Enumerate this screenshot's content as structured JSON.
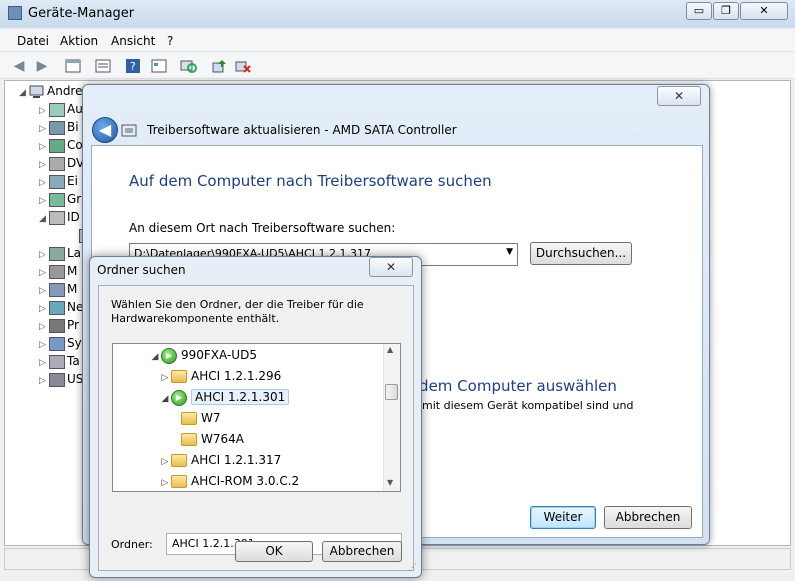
{
  "window": {
    "title": "Geräte-Manager",
    "minimize": "▭",
    "restore": "❐",
    "close": "✕"
  },
  "menu": [
    "Datei",
    "Aktion",
    "Ansicht",
    "?"
  ],
  "tree": {
    "root": "Andre",
    "items": [
      "Au",
      "Bi",
      "Co",
      "DV",
      "Ei",
      "Gr",
      "ID",
      "",
      "La",
      "M",
      "M",
      "Ne",
      "Pr",
      "Sy",
      "Ta",
      "US"
    ]
  },
  "update_dialog": {
    "header": "Treibersoftware aktualisieren - AMD SATA Controller",
    "heading": "Auf dem Computer nach Treibersoftware suchen",
    "location_label": "An diesem Ort nach Treibersoftware suchen:",
    "location_value": "D:\\Datenlager\\990FXA-UD5\\AHCI 1.2.1.317",
    "browse_button": "Durchsuchen...",
    "option2_title_fragment": "f dem Computer auswählen",
    "option2_desc_fragment": "mit diesem Gerät kompatibel sind und",
    "next_button": "Weiter",
    "cancel_button": "Abbrechen",
    "close": "✕"
  },
  "browse_dialog": {
    "title": "Ordner suchen",
    "instruction": "Wählen Sie den Ordner, der die Treiber für die Hardwarekomponente enthält.",
    "folders": [
      {
        "label": "990FXA-UD5",
        "indent": 0,
        "expanded": true,
        "icon": "drive"
      },
      {
        "label": "AHCI 1.2.1.296",
        "indent": 1,
        "expanded": false,
        "icon": "folder"
      },
      {
        "label": "AHCI 1.2.1.301",
        "indent": 1,
        "expanded": true,
        "icon": "drive",
        "selected": true
      },
      {
        "label": "W7",
        "indent": 2,
        "expanded": null,
        "icon": "folder"
      },
      {
        "label": "W764A",
        "indent": 2,
        "expanded": null,
        "icon": "folder"
      },
      {
        "label": "AHCI 1.2.1.317",
        "indent": 1,
        "expanded": false,
        "icon": "folder"
      },
      {
        "label": "AHCI-ROM 3.0.C.2",
        "indent": 1,
        "expanded": false,
        "icon": "folder"
      }
    ],
    "folder_label": "Ordner:",
    "folder_value": "AHCI 1.2.1.301",
    "ok_button": "OK",
    "cancel_button": "Abbrechen",
    "close": "✕"
  }
}
